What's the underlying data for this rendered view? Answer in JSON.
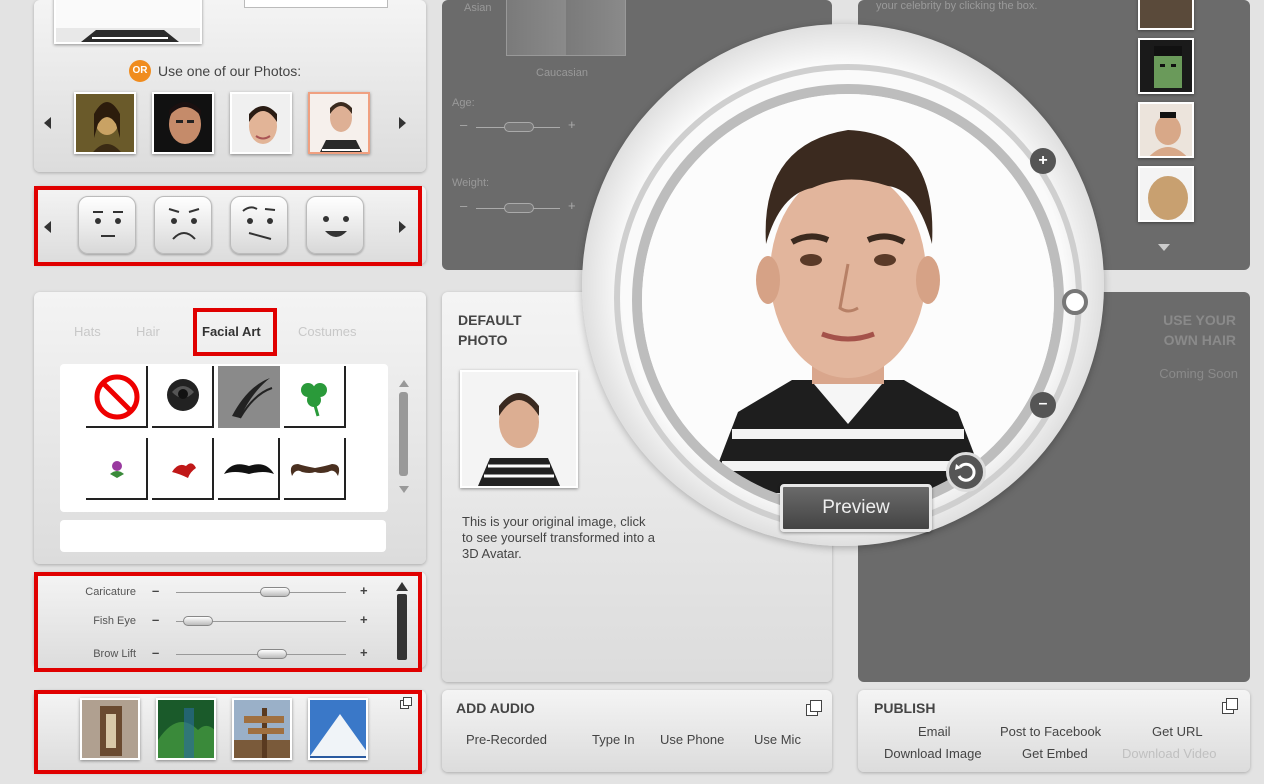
{
  "photos": {
    "or_badge": "OR",
    "use_ours_label": "Use one of our Photos:"
  },
  "features": {
    "tabs": [
      "Hats",
      "Hair",
      "Facial Art",
      "Costumes"
    ],
    "active_tab": "Facial Art"
  },
  "sliders": [
    {
      "label": "Caricature",
      "value": 0.6
    },
    {
      "label": "Fish Eye",
      "value": 0.05
    },
    {
      "label": "Brow Lift",
      "value": 0.58
    }
  ],
  "adjust": {
    "top_label": "Asian",
    "ethnicity_label": "Caucasian",
    "age_label": "Age:",
    "weight_label": "Weight:"
  },
  "celebrity": {
    "hint": "your celebrity by clicking the box."
  },
  "default_photo": {
    "title_line1": "DEFAULT",
    "title_line2": "PHOTO",
    "description_line1": "This is your original image, click",
    "description_line2": "to see yourself transformed into a",
    "description_line3": "3D Avatar."
  },
  "preview": {
    "button_label": "Preview"
  },
  "hair": {
    "title_line1": "USE YOUR",
    "title_line2": "OWN HAIR",
    "subtitle": "Coming Soon"
  },
  "audio": {
    "title": "ADD AUDIO",
    "options": [
      "Pre-Recorded",
      "Type In",
      "Use Phone",
      "Use Mic"
    ]
  },
  "publish": {
    "title": "PUBLISH",
    "row1": [
      "Email",
      "Post to Facebook",
      "Get URL"
    ],
    "row2": [
      "Download Image",
      "Get Embed",
      "Download Video"
    ]
  },
  "colors": {
    "highlight": "#e00000",
    "dark_panel": "#6b6b6b"
  }
}
